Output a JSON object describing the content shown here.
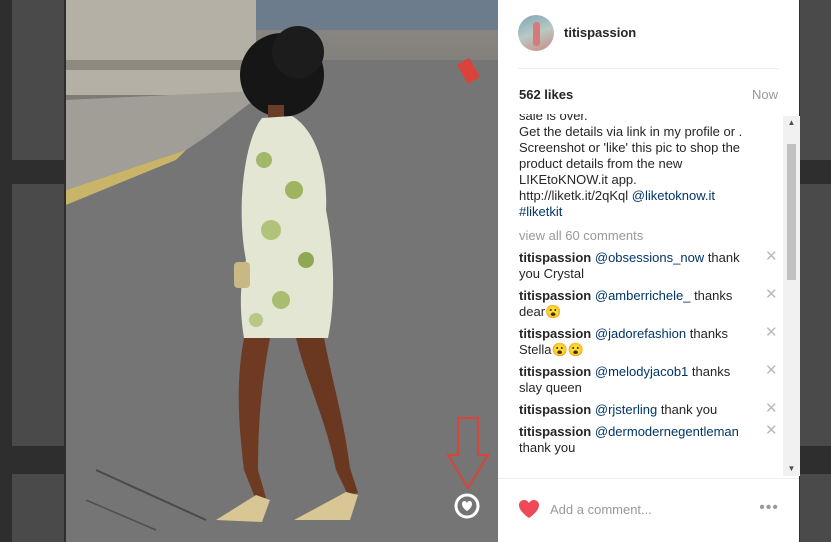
{
  "post": {
    "username": "titispassion",
    "likes": "562 likes",
    "timestamp": "Now",
    "caption_lines": [
      "sale is over.",
      "Get the details via link in my profile or .",
      "Screenshot or 'like' this pic to shop the",
      "product details from the new",
      "LIKEtoKNOW.it app."
    ],
    "caption_link": "http://liketk.it/2qKql",
    "caption_mention": "@liketoknow.it",
    "caption_tag": "#liketkit",
    "view_all": "view all 60 comments",
    "comments": [
      {
        "author": "titispassion",
        "mention": "@obsessions_now",
        "text": " thank you Crystal"
      },
      {
        "author": "titispassion",
        "mention": "@amberrichele_",
        "text": " thanks dear😮"
      },
      {
        "author": "titispassion",
        "mention": "@jadorefashion",
        "text": " thanks Stella😮😮"
      },
      {
        "author": "titispassion",
        "mention": "@melodyjacob1",
        "text": " thanks slay queen"
      },
      {
        "author": "titispassion",
        "mention": "@rjsterling",
        "text": " thank you"
      },
      {
        "author": "titispassion",
        "mention": "@dermodernegentleman",
        "text": " thank you"
      }
    ],
    "close_glyph": "✕",
    "comment_placeholder": "Add a comment...",
    "more_glyph": "•••"
  },
  "icons": {
    "heart": "heart-icon",
    "liketoknow": "liketoknow-badge-icon",
    "arrow": "red-down-arrow-annotation",
    "close": "close-icon",
    "more": "more-options-icon"
  },
  "colors": {
    "heart": "#ed4956",
    "link": "#003569",
    "annotation_arrow": "#d9433a"
  }
}
